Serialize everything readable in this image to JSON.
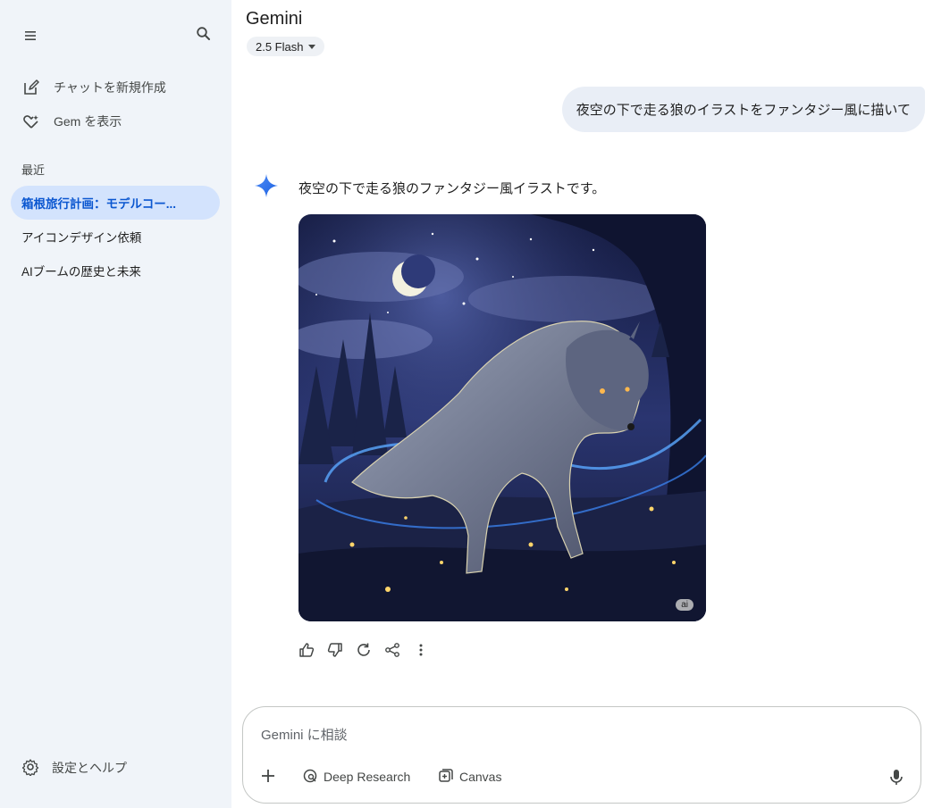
{
  "sidebar": {
    "new_chat": "チャットを新規作成",
    "gems": "Gem を表示",
    "recent_label": "最近",
    "recent": [
      {
        "label": "箱根旅行計画：モデルコー..."
      },
      {
        "label": "アイコンデザイン依頼"
      },
      {
        "label": "AIブームの歴史と未来"
      }
    ],
    "settings": "設定とヘルプ"
  },
  "header": {
    "title": "Gemini",
    "model": "2.5 Flash"
  },
  "conversation": {
    "user_message": "夜空の下で走る狼のイラストをファンタジー風に描いて",
    "response_text": "夜空の下で走る狼のファンタジー風イラストです。",
    "image_badge": "ai"
  },
  "input": {
    "placeholder": "Gemini に相談",
    "tools": [
      {
        "label": "Deep Research",
        "icon": "deep-research-icon"
      },
      {
        "label": "Canvas",
        "icon": "canvas-icon"
      }
    ]
  },
  "colors": {
    "sidebar_bg": "#f0f4f9",
    "active_item_bg": "#d3e3fd",
    "active_item_text": "#0b57d0",
    "user_bubble_bg": "#e9eef6"
  }
}
